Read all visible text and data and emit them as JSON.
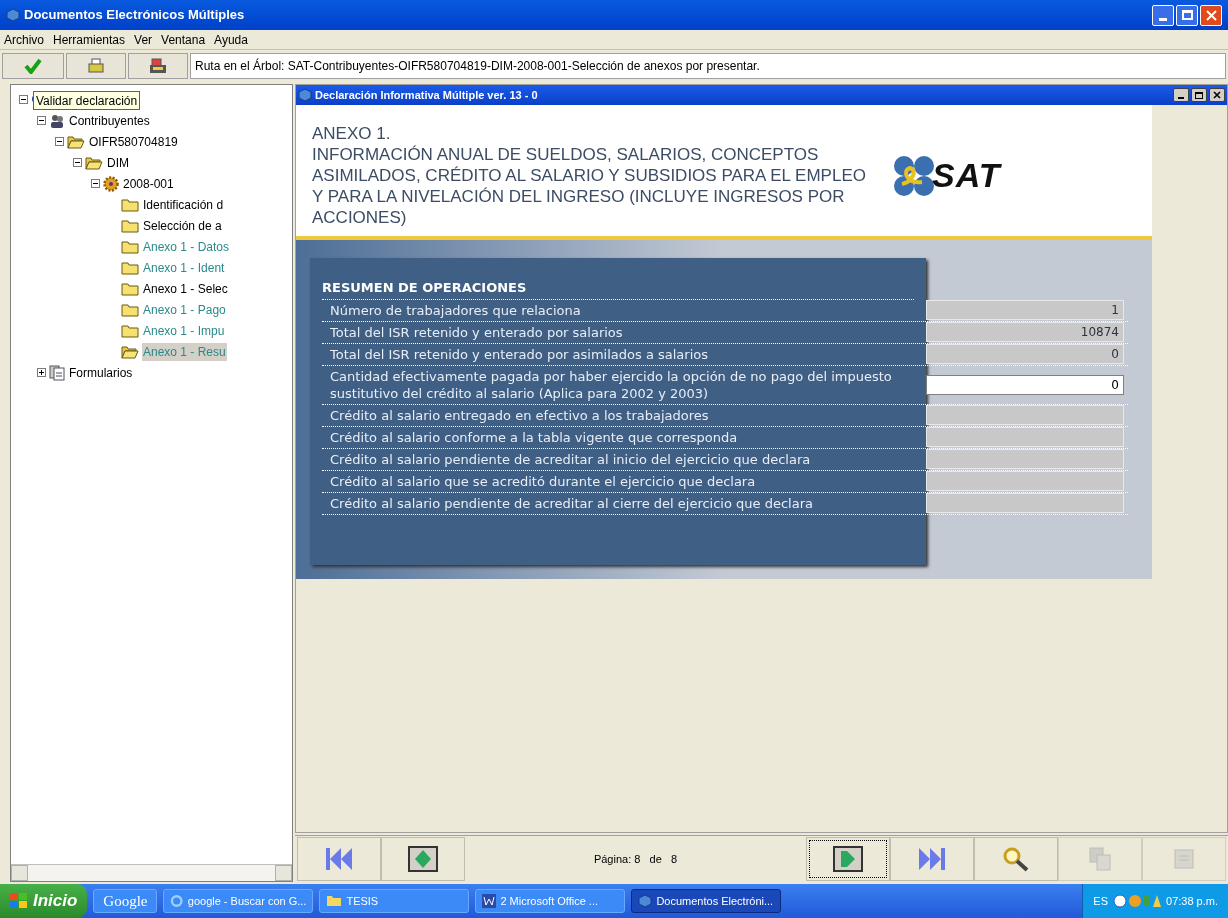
{
  "window": {
    "title": "Documentos Electrónicos Múltiples"
  },
  "menu": [
    "Archivo",
    "Herramientas",
    "Ver",
    "Ventana",
    "Ayuda"
  ],
  "path": "Ruta en el Árbol: SAT-Contribuyentes-OIFR580704819-DIM-2008-001-Selección de anexos por presentar.",
  "tooltip": "Validar declaración",
  "tree": [
    {
      "kind": "root",
      "expanded": true,
      "children": [
        {
          "kind": "people",
          "label": "Contribuyentes",
          "expanded": true,
          "children": [
            {
              "kind": "open-folder",
              "label": "OIFR580704819",
              "expanded": true,
              "children": [
                {
                  "kind": "open-folder",
                  "label": "DIM",
                  "expanded": true,
                  "children": [
                    {
                      "kind": "gear",
                      "label": "2008-001",
                      "expanded": true,
                      "children": [
                        {
                          "kind": "folder",
                          "label": "Identificación d",
                          "color": "#000000",
                          "selected": false
                        },
                        {
                          "kind": "folder",
                          "label": "Selección de a",
                          "color": "#000000",
                          "selected": false
                        },
                        {
                          "kind": "folder",
                          "label": "Anexo 1 - Datos",
                          "color": "#2a8a8a",
                          "selected": false
                        },
                        {
                          "kind": "folder",
                          "label": "Anexo 1 - Ident",
                          "color": "#2a8a8a",
                          "selected": false
                        },
                        {
                          "kind": "folder",
                          "label": "Anexo 1 - Selec",
                          "color": "#000000",
                          "selected": false
                        },
                        {
                          "kind": "folder",
                          "label": "Anexo 1 - Pago",
                          "color": "#2a8a8a",
                          "selected": false
                        },
                        {
                          "kind": "folder",
                          "label": "Anexo 1 - Impu",
                          "color": "#2a8a8a",
                          "selected": false
                        },
                        {
                          "kind": "open-folder",
                          "label": "Anexo 1 - Resu",
                          "color": "#2a8a8a",
                          "selected": true
                        }
                      ]
                    }
                  ]
                }
              ]
            }
          ]
        },
        {
          "kind": "forms",
          "label": "Formularios",
          "expanded": false
        }
      ]
    }
  ],
  "inner_window": {
    "title": "Declaración Informativa Múltiple ver. 13 - 0"
  },
  "heading": "ANEXO 1.",
  "subheading": "INFORMACIÓN ANUAL DE SUELDOS, SALARIOS, CONCEPTOS ASIMILADOS, CRÉDITO AL SALARIO Y SUBSIDIOS PARA EL EMPLEO Y PARA LA NIVELACIÓN DEL INGRESO (INCLUYE INGRESOS POR ACCIONES)",
  "logo_text": "SAT",
  "section_title": "RESUMEN DE OPERACIONES",
  "rows": [
    {
      "label": "Número de trabajadores que relaciona",
      "value": "1",
      "disabled": true
    },
    {
      "label": "Total del ISR retenido y enterado por salarios",
      "value": "10874",
      "disabled": true
    },
    {
      "label": "Total del ISR retenido y enterado por asimilados a salarios",
      "value": "0",
      "disabled": true
    },
    {
      "label": "Cantidad efectivamente pagada por haber ejercido la opción de no pago del impuesto sustitutivo del crédito al salario (Aplica para 2002 y 2003)",
      "value": "0",
      "disabled": false
    },
    {
      "label": "Crédito al salario entregado en efectivo a los trabajadores",
      "disabled": true
    },
    {
      "label": "Crédito al salario conforme a la tabla vigente que corresponda",
      "disabled": true
    },
    {
      "label": "Crédito al salario pendiente de acreditar al inicio del ejercicio que declara",
      "disabled": true
    },
    {
      "label": "Crédito al salario que se acreditó durante el ejercicio que declara",
      "disabled": true
    },
    {
      "label": "Crédito al salario pendiente de acreditar al cierre del ejercicio que declara",
      "disabled": true
    }
  ],
  "page_label": "Página: 8   de   8",
  "nav_buttons": [
    {
      "kind": "first",
      "disabled": false,
      "focused": false
    },
    {
      "kind": "prev",
      "disabled": false,
      "focused": false
    },
    {
      "kind": "page"
    },
    {
      "kind": "next",
      "disabled": false,
      "focused": true
    },
    {
      "kind": "last",
      "disabled": false,
      "focused": false
    },
    {
      "kind": "zoom",
      "disabled": false,
      "focused": false
    },
    {
      "kind": "copy",
      "disabled": true,
      "focused": false
    },
    {
      "kind": "export",
      "disabled": true,
      "focused": false
    }
  ],
  "taskbar": {
    "start": "Inicio",
    "items": [
      {
        "kind": "google",
        "label": "Google",
        "active": false
      },
      {
        "kind": "browser",
        "label": "google - Buscar con G...",
        "active": false
      },
      {
        "kind": "folder",
        "label": "TESIS",
        "active": false
      },
      {
        "kind": "word",
        "label": "2 Microsoft Office ...",
        "active": false
      },
      {
        "kind": "app",
        "label": "Documentos Electróni...",
        "active": true
      }
    ],
    "language": "ES",
    "clock": "07:38 p.m."
  }
}
